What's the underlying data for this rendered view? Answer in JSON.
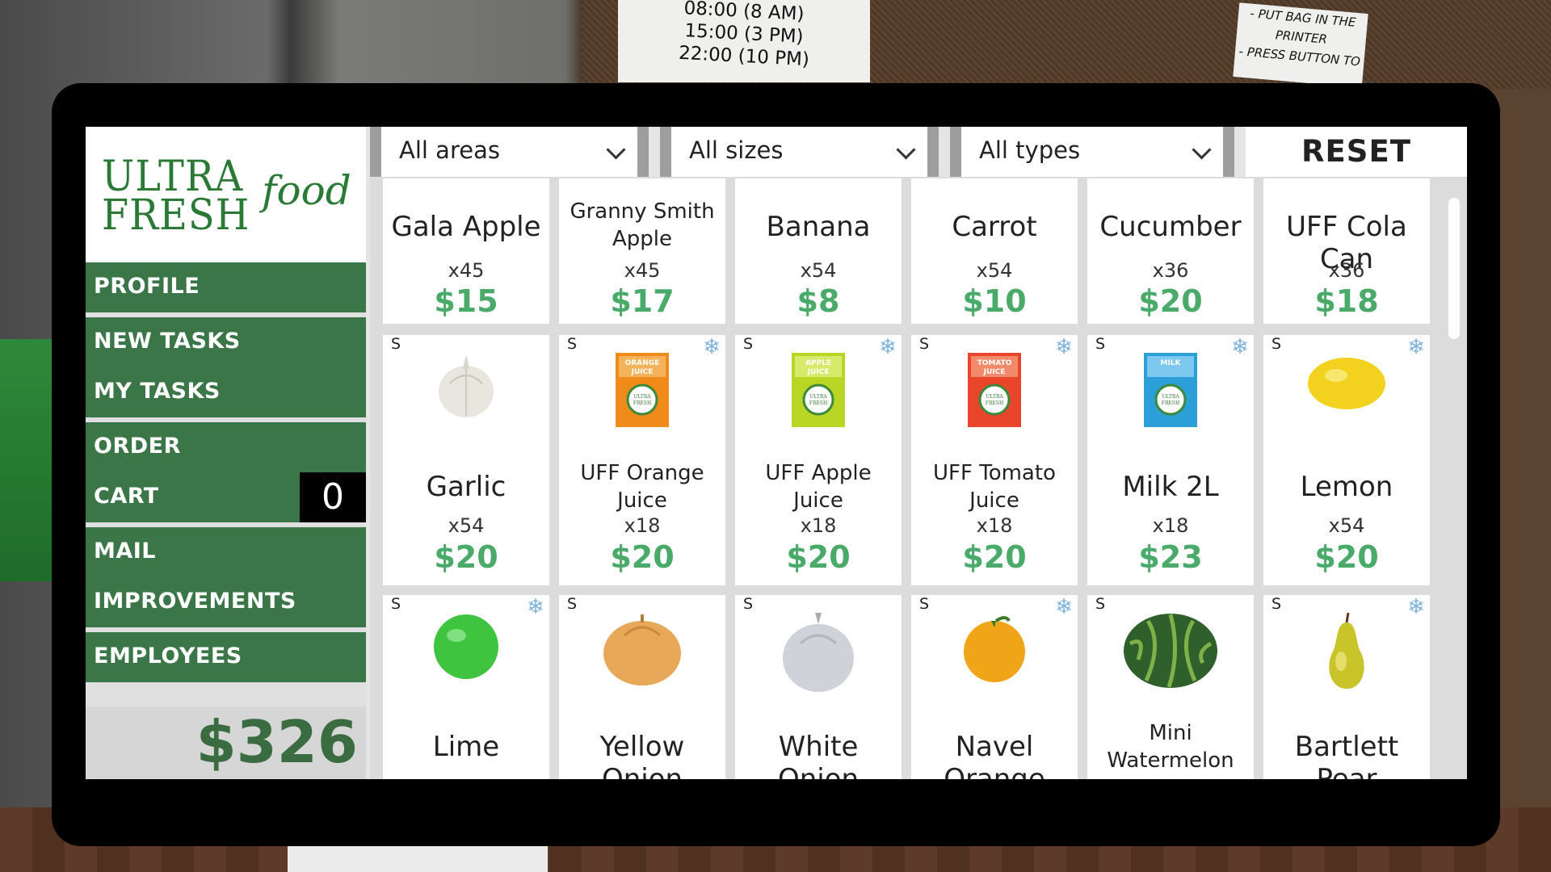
{
  "scene": {
    "note_times": [
      "08:00 (8 AM)",
      "15:00 (3 PM)",
      "22:00 (10 PM)"
    ],
    "note_instructions": [
      "- PUT BAG IN THE",
      "PRINTER",
      "- PRESS BUTTON TO"
    ]
  },
  "logo": {
    "line1": "ULTRA",
    "line2": "FRESH",
    "tagline": "food"
  },
  "nav": {
    "profile": "PROFILE",
    "new_tasks": "NEW TASKS",
    "my_tasks": "MY TASKS",
    "order": "ORDER",
    "cart": "CART",
    "cart_count": "0",
    "mail": "MAIL",
    "improvements": "IMPROVEMENTS",
    "employees": "EMPLOYEES"
  },
  "balance": "$326",
  "filters": {
    "areas": "All areas",
    "sizes": "All sizes",
    "types": "All types",
    "reset": "RESET"
  },
  "products": [
    {
      "name": "Gala Apple",
      "qty": "x45",
      "price": "$15",
      "size": "",
      "frozen": false,
      "icon": "apple-icon"
    },
    {
      "name": "Granny Smith Apple",
      "qty": "x45",
      "price": "$17",
      "size": "",
      "frozen": false,
      "icon": "apple-icon"
    },
    {
      "name": "Banana",
      "qty": "x54",
      "price": "$8",
      "size": "",
      "frozen": false,
      "icon": "banana-icon"
    },
    {
      "name": "Carrot",
      "qty": "x54",
      "price": "$10",
      "size": "",
      "frozen": false,
      "icon": "carrot-icon"
    },
    {
      "name": "Cucumber",
      "qty": "x36",
      "price": "$20",
      "size": "",
      "frozen": false,
      "icon": "cucumber-icon"
    },
    {
      "name": "UFF Cola Can",
      "qty": "x36",
      "price": "$18",
      "size": "",
      "frozen": false,
      "icon": "can-icon"
    },
    {
      "name": "Garlic",
      "qty": "x54",
      "price": "$20",
      "size": "S",
      "frozen": false,
      "icon": "garlic-icon"
    },
    {
      "name": "UFF Orange Juice",
      "qty": "x18",
      "price": "$20",
      "size": "S",
      "frozen": true,
      "icon": "orange-juice-carton-icon",
      "carton_label": "ORANGE JUICE"
    },
    {
      "name": "UFF Apple Juice",
      "qty": "x18",
      "price": "$20",
      "size": "S",
      "frozen": true,
      "icon": "apple-juice-carton-icon",
      "carton_label": "APPLE JUICE"
    },
    {
      "name": "UFF Tomato Juice",
      "qty": "x18",
      "price": "$20",
      "size": "S",
      "frozen": true,
      "icon": "tomato-juice-carton-icon",
      "carton_label": "TOMATO JUICE"
    },
    {
      "name": "Milk 2L",
      "qty": "x18",
      "price": "$23",
      "size": "S",
      "frozen": true,
      "icon": "milk-carton-icon",
      "carton_label": "MILK"
    },
    {
      "name": "Lemon",
      "qty": "x54",
      "price": "$20",
      "size": "S",
      "frozen": true,
      "icon": "lemon-icon"
    },
    {
      "name": "Lime",
      "qty": "",
      "price": "",
      "size": "S",
      "frozen": true,
      "icon": "lime-icon"
    },
    {
      "name": "Yellow Onion",
      "qty": "",
      "price": "",
      "size": "S",
      "frozen": false,
      "icon": "yellow-onion-icon"
    },
    {
      "name": "White Onion",
      "qty": "",
      "price": "",
      "size": "S",
      "frozen": false,
      "icon": "white-onion-icon"
    },
    {
      "name": "Navel Orange",
      "qty": "",
      "price": "",
      "size": "S",
      "frozen": true,
      "icon": "orange-icon"
    },
    {
      "name": "Mini Watermelon",
      "qty": "",
      "price": "",
      "size": "S",
      "frozen": false,
      "icon": "watermelon-icon"
    },
    {
      "name": "Bartlett Pear",
      "qty": "",
      "price": "",
      "size": "S",
      "frozen": true,
      "icon": "pear-icon"
    }
  ],
  "colors": {
    "nav_green": "#3a7647",
    "price_green": "#4aaa6a",
    "logo_green": "#2a7a36",
    "frozen_blue": "#7fb3dd"
  }
}
